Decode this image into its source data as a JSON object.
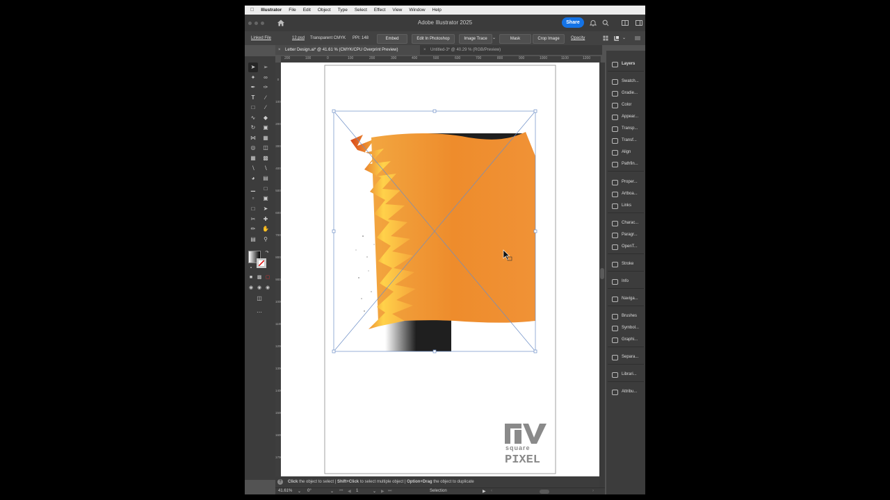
{
  "menubar": {
    "app_name": "Illustrator",
    "items": [
      "File",
      "Edit",
      "Object",
      "Type",
      "Select",
      "Effect",
      "View",
      "Window",
      "Help"
    ]
  },
  "titlebar": {
    "title": "Adobe Illustrator 2025",
    "share_label": "Share"
  },
  "control_bar": {
    "linked_file": "Linked File",
    "file_name": "12.psd",
    "color_info": "Transparent CMYK",
    "ppi": "PPI: 148",
    "embed": "Embed",
    "edit_in_photoshop": "Edit In Photoshop",
    "image_trace": "Image Trace",
    "mask": "Mask",
    "crop_image": "Crop Image",
    "opacity": "Opacity"
  },
  "tabs": [
    {
      "label": "Letter Design.ai* @ 41.61 % (CMYK/CPU Overprint Preview)",
      "active": true
    },
    {
      "label": "Untitled-3* @ 40.29 % (RGB/Preview)",
      "active": false
    }
  ],
  "ruler": {
    "h_ticks": [
      "200",
      "100",
      "0",
      "100",
      "200",
      "300",
      "400",
      "500",
      "600",
      "700",
      "800",
      "900",
      "1000",
      "1100",
      "1200"
    ],
    "v_ticks": [
      "0",
      "100",
      "200",
      "300",
      "400",
      "500",
      "600",
      "700",
      "800",
      "900",
      "1000",
      "1100",
      "1200",
      "1300",
      "1400",
      "1500",
      "1600",
      "1700"
    ]
  },
  "panels": [
    {
      "label": "Layers",
      "icon": "layers-icon"
    },
    {
      "label": "Swatch...",
      "icon": "swatches-icon"
    },
    {
      "label": "Gradie...",
      "icon": "gradient-icon"
    },
    {
      "label": "Color",
      "icon": "color-icon"
    },
    {
      "label": "Appear...",
      "icon": "appearance-icon"
    },
    {
      "label": "Transp...",
      "icon": "transparency-icon"
    },
    {
      "label": "Transf...",
      "icon": "transform-icon"
    },
    {
      "label": "Align",
      "icon": "align-icon"
    },
    {
      "label": "Pathfin...",
      "icon": "pathfinder-icon"
    },
    {
      "label": "Proper...",
      "icon": "properties-icon"
    },
    {
      "label": "Artboa...",
      "icon": "artboards-icon"
    },
    {
      "label": "Links",
      "icon": "links-icon"
    },
    {
      "label": "Charac...",
      "icon": "character-icon"
    },
    {
      "label": "Paragr...",
      "icon": "paragraph-icon"
    },
    {
      "label": "OpenT...",
      "icon": "opentype-icon"
    },
    {
      "label": "Stroke",
      "icon": "stroke-icon"
    },
    {
      "label": "Info",
      "icon": "info-icon"
    },
    {
      "label": "Naviga...",
      "icon": "navigator-icon"
    },
    {
      "label": "Brushes",
      "icon": "brushes-icon"
    },
    {
      "label": "Symbol...",
      "icon": "symbols-icon"
    },
    {
      "label": "Graphi...",
      "icon": "graphic-styles-icon"
    },
    {
      "label": "Separa...",
      "icon": "separations-icon"
    },
    {
      "label": "Librari...",
      "icon": "libraries-icon"
    },
    {
      "label": "Attribu...",
      "icon": "attributes-icon"
    }
  ],
  "hint": {
    "click": "Click",
    "click_text": "the object to select",
    "shift": "Shift+Click",
    "shift_text": "to select multiple object",
    "option": "Option+Drag",
    "option_text": "the object to duplicate",
    "sep": "|"
  },
  "status": {
    "zoom": "41.61%",
    "rotation": "0°",
    "artboard": "1",
    "tool": "Selection"
  },
  "watermark": {
    "line1": "square",
    "line2": "PIXEL"
  },
  "colors": {
    "accent": "#1473e6",
    "orange": "#ee8a2a",
    "selection": "#6c8ec6"
  }
}
